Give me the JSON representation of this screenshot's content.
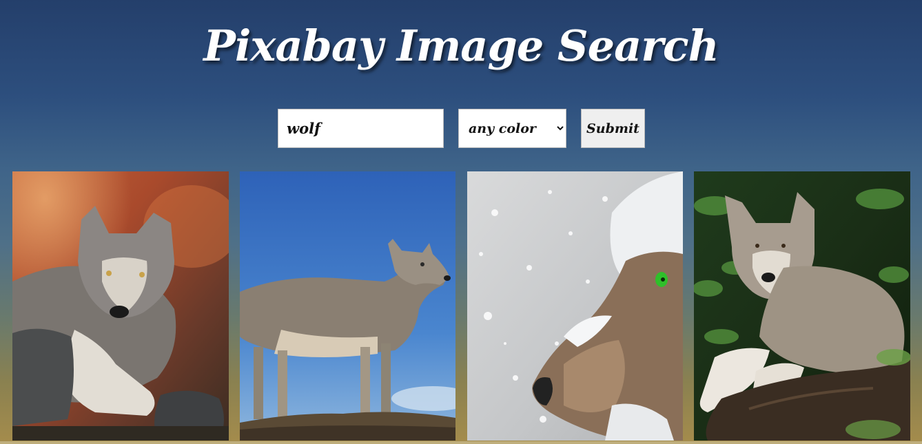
{
  "header": {
    "title": "Pixabay Image Search"
  },
  "search": {
    "query_value": "wolf",
    "color_selected": "any color",
    "submit_label": "Submit"
  },
  "results": {
    "images": [
      {
        "subject": "wolf lying among rocks, autumn background"
      },
      {
        "subject": "wolf standing on rock against blue sky"
      },
      {
        "subject": "wolf face in snowfall with green eye"
      },
      {
        "subject": "wolf lying on log in forest"
      }
    ]
  },
  "colors": {
    "background_top": "#243f6b",
    "background_bottom": "#a58c4c",
    "title_color": "#ffffff"
  }
}
